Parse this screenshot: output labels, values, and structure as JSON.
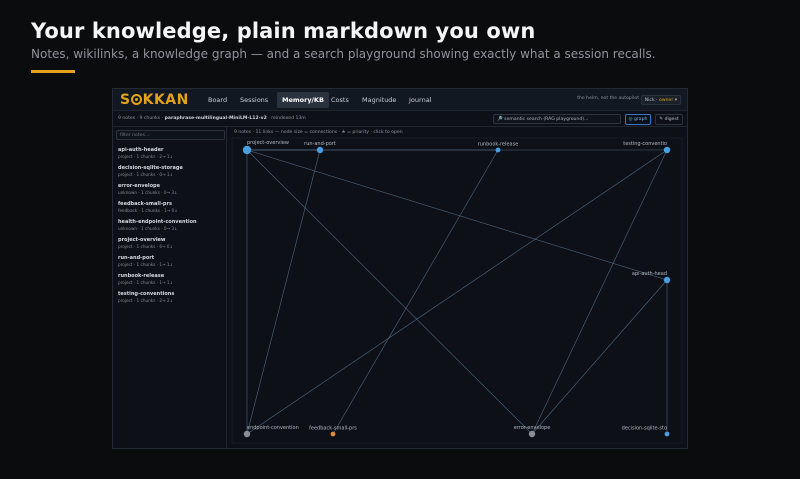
{
  "hero": {
    "title": "Your knowledge, plain markdown you own",
    "subtitle": "Notes, wikilinks, a knowledge graph — and a search playground showing exactly what a session recalls.",
    "accent": "#e3a21a"
  },
  "app": {
    "logo": {
      "pre": "S",
      "post": "KKAN"
    },
    "tabs": [
      {
        "label": "Board",
        "active": false
      },
      {
        "label": "Sessions",
        "active": false
      },
      {
        "label": "Memory/KB",
        "active": true
      },
      {
        "label": "Costs",
        "active": false
      },
      {
        "label": "Magnitude",
        "active": false
      },
      {
        "label": "Journal",
        "active": false
      }
    ],
    "tagline": "the helm, not the autopilot",
    "user": {
      "name": "Nick",
      "role": "owner",
      "chevron": "▾"
    },
    "meta": {
      "counts": "9 notes · 9 chunks ·",
      "model": "paraphrase-multilingual-MiniLM-L12-v2",
      "indexed": "· reindexed 13m"
    },
    "search_label": "🔎 semantic search (RAG playground)...",
    "graph_button": "◎ graph",
    "digest_button": "✎ digest",
    "filter_placeholder": "filter notes...",
    "graph_info": "9 notes · 11 links — node size = connections · ★ = priority · click to open",
    "notes": [
      {
        "name": "api-auth-header",
        "meta": "project · 1 chunks · 2→ 1↓"
      },
      {
        "name": "decision-sqlite-storage",
        "meta": "project · 1 chunks · 0→ 1↓"
      },
      {
        "name": "error-envelope",
        "meta": "unknown · 1 chunks · 0→ 3↓"
      },
      {
        "name": "feedback-small-prs",
        "meta": "feedback · 1 chunks · 1→ 0↓"
      },
      {
        "name": "health-endpoint-convention",
        "meta": "unknown · 1 chunks · 0→ 3↓"
      },
      {
        "name": "project-overview",
        "meta": "project · 1 chunks · 6→ 0↓"
      },
      {
        "name": "run-and-port",
        "meta": "project · 1 chunks · 1→ 1↓"
      },
      {
        "name": "runbook-release",
        "meta": "project · 1 chunks · 1→ 1↓"
      },
      {
        "name": "testing-conventions",
        "meta": "project · 1 chunks · 2→ 2↓"
      }
    ],
    "graph": {
      "nodes": [
        {
          "id": "project-overview",
          "label": "project-overview",
          "color": "#4a9fe0",
          "size": "large"
        },
        {
          "id": "run-and-port",
          "label": "run-and-port",
          "color": "#4a9fe0",
          "size": "medium"
        },
        {
          "id": "runbook-release",
          "label": "runbook-release",
          "color": "#4a9fe0",
          "size": "small"
        },
        {
          "id": "testing-conventions",
          "label": "testing-conventio",
          "color": "#4a9fe0",
          "size": "medium"
        },
        {
          "id": "api-auth-header",
          "label": "api-auth-head",
          "color": "#4a9fe0",
          "size": "medium"
        },
        {
          "id": "health-endpoint-convention",
          "label": "endpoint-convention",
          "color": "#8a8f96",
          "size": "medium"
        },
        {
          "id": "feedback-small-prs",
          "label": "feedback-small-prs",
          "color": "#e08a3a",
          "size": "small"
        },
        {
          "id": "error-envelope",
          "label": "error-envelope",
          "color": "#8a8f96",
          "size": "medium"
        },
        {
          "id": "decision-sqlite-storage",
          "label": "decision-sqlite-sto",
          "color": "#4a9fe0",
          "size": "small"
        }
      ],
      "links": [
        [
          "project-overview",
          "run-and-port"
        ],
        [
          "project-overview",
          "runbook-release"
        ],
        [
          "project-overview",
          "testing-conventions"
        ],
        [
          "project-overview",
          "api-auth-header"
        ],
        [
          "project-overview",
          "error-envelope"
        ],
        [
          "project-overview",
          "health-endpoint-convention"
        ],
        [
          "run-and-port",
          "health-endpoint-convention"
        ],
        [
          "runbook-release",
          "feedback-small-prs"
        ],
        [
          "testing-conventions",
          "health-endpoint-convention"
        ],
        [
          "testing-conventions",
          "error-envelope"
        ],
        [
          "api-auth-header",
          "error-envelope"
        ],
        [
          "api-auth-header",
          "decision-sqlite-storage"
        ]
      ],
      "link_color": "#56708a"
    }
  }
}
